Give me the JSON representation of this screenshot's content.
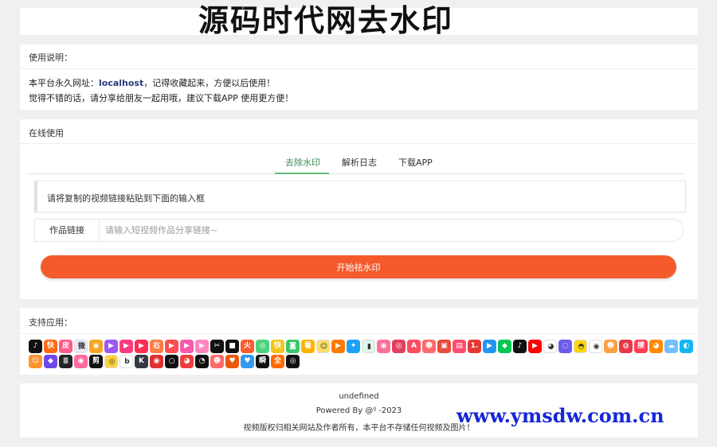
{
  "header": {
    "title": "源码时代网去水印"
  },
  "usage": {
    "heading": "使用说明：",
    "line1_prefix": "本平台永久网址：",
    "line1_host": "localhost",
    "line1_suffix": "，记得收藏起来，方便以后使用！",
    "line2": "觉得不错的话，请分享给朋友一起用哦，建议下载APP 使用更方便！"
  },
  "online": {
    "heading": "在线使用",
    "tabs": [
      {
        "label": "去除水印",
        "active": true
      },
      {
        "label": "解析日志",
        "active": false
      },
      {
        "label": "下载APP",
        "active": false
      }
    ],
    "hint": "请将复制的视频链接粘贴到下面的输入框",
    "link_label": "作品链接",
    "link_placeholder": "请输入短视频作品分享链接~",
    "start_button": "开始祛水印",
    "accent_color": "#5fb878",
    "button_color": "#f45a2b"
  },
  "support": {
    "heading": "支持应用：",
    "apps": [
      {
        "icon": "douyin-icon",
        "color": "#111111",
        "glyph": "♪"
      },
      {
        "icon": "kuaishou-icon",
        "color": "#ff6a13",
        "glyph": "快"
      },
      {
        "icon": "pipixia-icon",
        "color": "#ff5a8a",
        "glyph": "皮"
      },
      {
        "icon": "weishi-icon",
        "color": "#e8e8f8",
        "glyph": "微"
      },
      {
        "icon": "weibo-icon",
        "color": "#f5a623",
        "glyph": "◉"
      },
      {
        "icon": "video-icon",
        "color": "#9b59f0",
        "glyph": "▶"
      },
      {
        "icon": "player-icon",
        "color": "#ff3b7f",
        "glyph": "▶"
      },
      {
        "icon": "play-icon",
        "color": "#ff2d55",
        "glyph": "▶"
      },
      {
        "icon": "zuiyou-icon",
        "color": "#ff7a45",
        "glyph": "右"
      },
      {
        "icon": "video2-icon",
        "color": "#ff4d4f",
        "glyph": "▶"
      },
      {
        "icon": "video3-icon",
        "color": "#f759ab",
        "glyph": "▶"
      },
      {
        "icon": "play2-icon",
        "color": "#ff85c0",
        "glyph": "▶"
      },
      {
        "icon": "capcut-icon",
        "color": "#111111",
        "glyph": "✂"
      },
      {
        "icon": "record-icon",
        "color": "#111111",
        "glyph": "■"
      },
      {
        "icon": "huoshan-icon",
        "color": "#ff5b2e",
        "glyph": "火"
      },
      {
        "icon": "app-icon",
        "color": "#4bd37b",
        "glyph": "◎"
      },
      {
        "icon": "kuaixiu-icon",
        "color": "#f5c518",
        "glyph": "快"
      },
      {
        "icon": "chat-icon",
        "color": "#37c86b",
        "glyph": "◙"
      },
      {
        "icon": "kandian-icon",
        "color": "#ffb300",
        "glyph": "看"
      },
      {
        "icon": "smile-icon",
        "color": "#ffe066",
        "glyph": "☺"
      },
      {
        "icon": "tencent-video-icon",
        "color": "#ff7a00",
        "glyph": "▶"
      },
      {
        "icon": "twitter-icon",
        "color": "#1da1f2",
        "glyph": "✦"
      },
      {
        "icon": "chart-icon",
        "color": "#dff5ea",
        "glyph": "▮"
      },
      {
        "icon": "bilibili-icon",
        "color": "#fb7299",
        "glyph": "◉"
      },
      {
        "icon": "instagram-icon",
        "color": "#e4405f",
        "glyph": "◎"
      },
      {
        "icon": "acfun-icon",
        "color": "#fd4c5d",
        "glyph": "A"
      },
      {
        "icon": "face-icon",
        "color": "#ff6b6b",
        "glyph": "☻"
      },
      {
        "icon": "photo-icon",
        "color": "#e74c3c",
        "glyph": "▣"
      },
      {
        "icon": "tv-icon",
        "color": "#ff4d6d",
        "glyph": "▤"
      },
      {
        "icon": "one-icon",
        "color": "#e53935",
        "glyph": "1."
      },
      {
        "icon": "youku-icon",
        "color": "#2196f3",
        "glyph": "▶"
      },
      {
        "icon": "iqiyi-icon",
        "color": "#00c853",
        "glyph": "◆"
      },
      {
        "icon": "tiktok-icon",
        "color": "#111111",
        "glyph": "♪"
      },
      {
        "icon": "youtube-icon",
        "color": "#ff0000",
        "glyph": "▶"
      },
      {
        "icon": "panda-icon",
        "color": "#ffffff",
        "glyph": "◕"
      },
      {
        "icon": "dots-icon",
        "color": "#6c5ce7",
        "glyph": "◌"
      },
      {
        "icon": "yellow-icon",
        "color": "#ffd60a",
        "glyph": "◓"
      },
      {
        "icon": "eye-icon",
        "color": "#ffffff",
        "glyph": "◉"
      },
      {
        "icon": "monkey-icon",
        "color": "#ff9f43",
        "glyph": "☻"
      },
      {
        "icon": "red-icon",
        "color": "#e63946",
        "glyph": "◍"
      },
      {
        "icon": "sohu-icon",
        "color": "#ff3d57",
        "glyph": "搜"
      },
      {
        "icon": "mango-icon",
        "color": "#ff8a00",
        "glyph": "◕"
      },
      {
        "icon": "cloud-icon",
        "color": "#74c0fc",
        "glyph": "☁"
      },
      {
        "icon": "qq-icon",
        "color": "#12b7f5",
        "glyph": "◐"
      },
      {
        "icon": "duck-icon",
        "color": "#ff922b",
        "glyph": "☺"
      },
      {
        "icon": "purple-icon",
        "color": "#7048e8",
        "glyph": "◆"
      },
      {
        "icon": "stack-icon",
        "color": "#212529",
        "glyph": "≣"
      },
      {
        "icon": "pink-icon",
        "color": "#ff6b9d",
        "glyph": "◉"
      },
      {
        "icon": "clip-icon",
        "color": "#111111",
        "glyph": "剪"
      },
      {
        "icon": "circle-icon",
        "color": "#ffd43b",
        "glyph": "◎"
      },
      {
        "icon": "b-icon",
        "color": "#ffffff",
        "glyph": "b"
      },
      {
        "icon": "k-icon",
        "color": "#343a40",
        "glyph": "K"
      },
      {
        "icon": "pin-icon",
        "color": "#e03131",
        "glyph": "◉"
      },
      {
        "icon": "ring-icon",
        "color": "#111111",
        "glyph": "○"
      },
      {
        "icon": "bird-icon",
        "color": "#f03e3e",
        "glyph": "◕"
      },
      {
        "icon": "panda2-icon",
        "color": "#111111",
        "glyph": "◔"
      },
      {
        "icon": "monkey2-icon",
        "color": "#ff6b6b",
        "glyph": "☻"
      },
      {
        "icon": "heart-icon",
        "color": "#e8590c",
        "glyph": "♥"
      },
      {
        "icon": "blue-heart-icon",
        "color": "#339af0",
        "glyph": "♥"
      },
      {
        "icon": "moment-icon",
        "color": "#111111",
        "glyph": "瞬"
      },
      {
        "icon": "full-icon",
        "color": "#ff6b00",
        "glyph": "全"
      },
      {
        "icon": "disc-icon",
        "color": "#111111",
        "glyph": "◎"
      }
    ]
  },
  "footer": {
    "line1": "undefined",
    "line2": "Powered By @ᴵᴶ        -2023",
    "line3": "视频版权归相关网站及作者所有，本平台不存储任何视频及图片！"
  },
  "watermark": "www.ymsdw.com.cn"
}
